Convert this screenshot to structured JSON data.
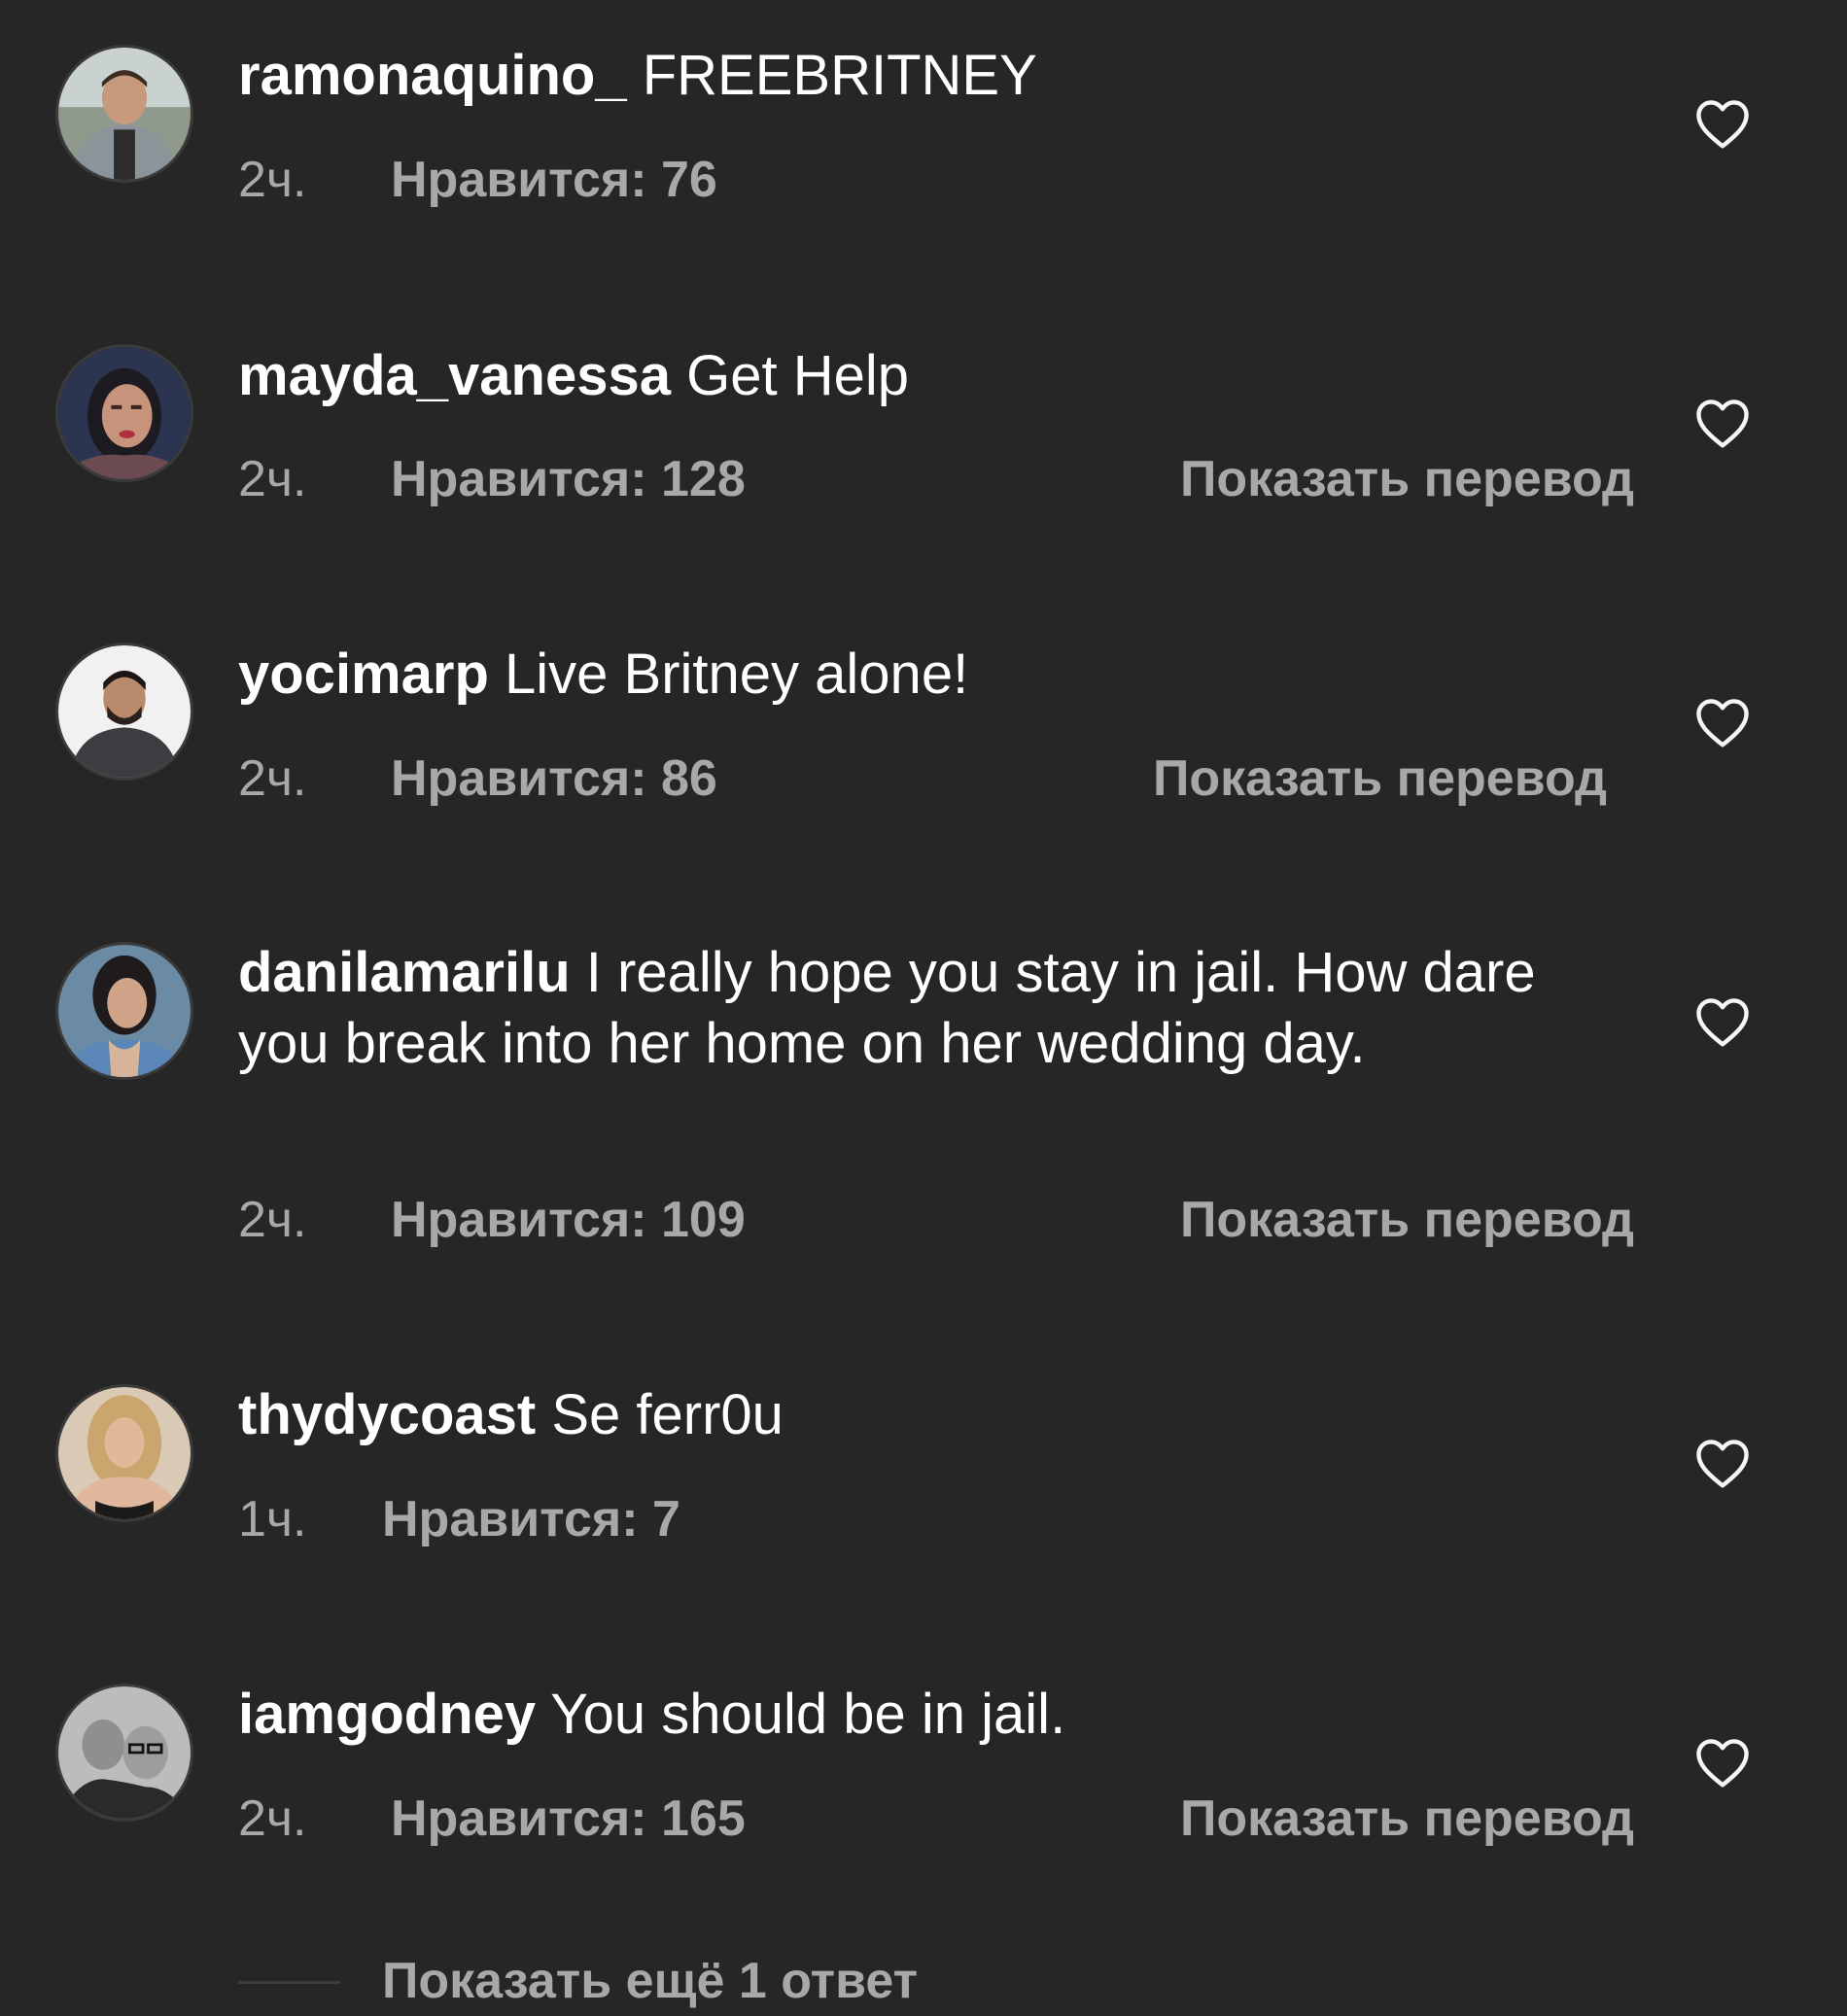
{
  "comments": [
    {
      "username": "ramonaquino_",
      "text": "FREEBRITNEY",
      "time": "2ч.",
      "likes": "Нравится: 76",
      "translate": "",
      "avatar": "avatar-man-gray-hoodie"
    },
    {
      "username": "mayda_vanessa",
      "text": "Get Help",
      "time": "2ч.",
      "likes": "Нравится: 128",
      "translate": "Показать перевод",
      "avatar": "avatar-woman-dark-hair"
    },
    {
      "username": "yocimarp",
      "text": "Live Britney alone!",
      "time": "2ч.",
      "likes": "Нравится: 86",
      "translate": "Показать перевод",
      "avatar": "avatar-man-beard"
    },
    {
      "username": "danilamarilu",
      "text": "I really hope you stay in jail. How dare you break into her home on her wedding day.",
      "time": "2ч.",
      "likes": "Нравится: 109",
      "translate": "Показать перевод",
      "avatar": "avatar-woman-denim"
    },
    {
      "username": "thydycoast",
      "text": "Se ferr0u",
      "time": "1ч.",
      "likes": "Нравится: 7",
      "translate": "",
      "avatar": "avatar-woman-blonde"
    },
    {
      "username": "iamgodney",
      "text": "You should be in jail.",
      "time": "2ч.",
      "likes": "Нравится: 165",
      "translate": "Показать перевод",
      "avatar": "avatar-bw-couple"
    }
  ],
  "more_replies": "Показать ещё 1 ответ",
  "colors": {
    "background": "#262626",
    "text": "#ffffff",
    "secondary": "#a8a8a8"
  },
  "icons": {
    "like": "heart-outline-icon"
  }
}
